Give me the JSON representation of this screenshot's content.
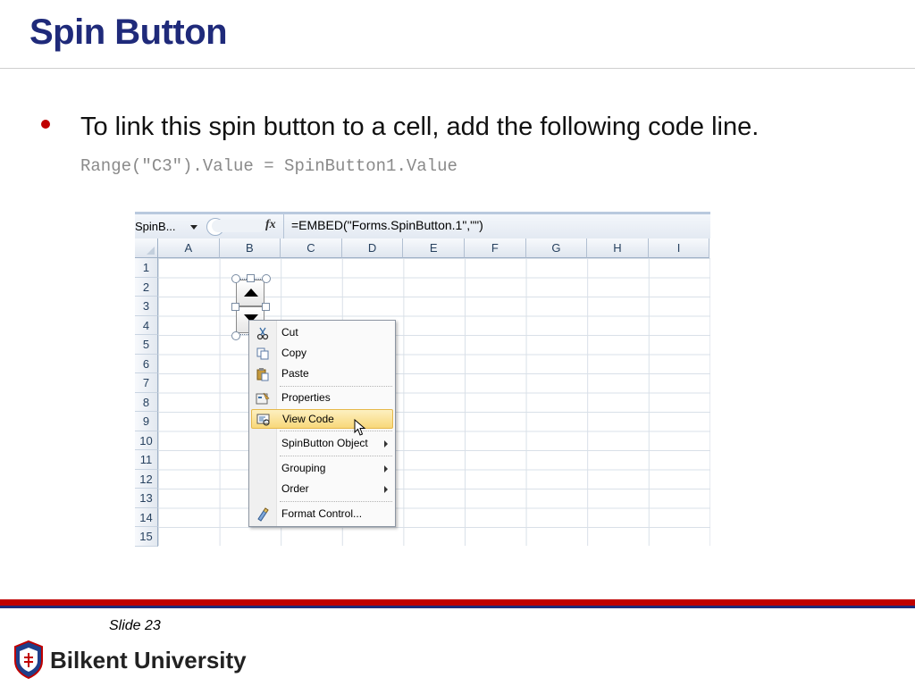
{
  "slide": {
    "title": "Spin Button",
    "bullet": "To link this spin button to a cell, add the following code line.",
    "code": "Range(\"C3\").Value = SpinButton1.Value",
    "slide_number": "Slide 23",
    "university": "Bilkent University"
  },
  "excel": {
    "name_box": "SpinB...",
    "fx_label": "fx",
    "formula": "=EMBED(\"Forms.SpinButton.1\",\"\")",
    "columns": [
      "A",
      "B",
      "C",
      "D",
      "E",
      "F",
      "G",
      "H",
      "I"
    ],
    "rows": [
      "1",
      "2",
      "3",
      "4",
      "5",
      "6",
      "7",
      "8",
      "9",
      "10",
      "11",
      "12",
      "13",
      "14",
      "15"
    ]
  },
  "context_menu": {
    "items": [
      {
        "label": "Cut",
        "icon": "scissors-icon",
        "submenu": false,
        "highlighted": false
      },
      {
        "label": "Copy",
        "icon": "copy-icon",
        "submenu": false,
        "highlighted": false
      },
      {
        "label": "Paste",
        "icon": "paste-icon",
        "submenu": false,
        "highlighted": false
      },
      {
        "label": "Properties",
        "icon": "properties-icon",
        "submenu": false,
        "highlighted": false
      },
      {
        "label": "View Code",
        "icon": "view-code-icon",
        "submenu": false,
        "highlighted": true
      },
      {
        "label": "SpinButton Object",
        "icon": "",
        "submenu": true,
        "highlighted": false
      },
      {
        "label": "Grouping",
        "icon": "",
        "submenu": true,
        "highlighted": false
      },
      {
        "label": "Order",
        "icon": "",
        "submenu": true,
        "highlighted": false
      },
      {
        "label": "Format Control...",
        "icon": "format-control-icon",
        "submenu": false,
        "highlighted": false
      }
    ]
  },
  "colors": {
    "title": "#1f2a7a",
    "bullet": "#c00000",
    "highlight": "#f8d87a"
  }
}
